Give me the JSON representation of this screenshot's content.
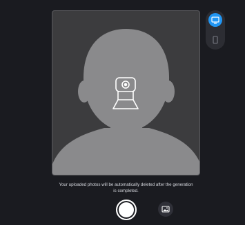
{
  "camera": {
    "placeholder_icon": "person-silhouette",
    "center_icon": "webcam-icon"
  },
  "device_toggle": {
    "options": [
      {
        "name": "desktop-icon",
        "selected": true
      },
      {
        "name": "mobile-icon",
        "selected": false
      }
    ],
    "accent_color": "#2196f3"
  },
  "notice": {
    "line1": "Your uploaded photos will be automatically deleted after the generation",
    "line2": "is completed."
  },
  "controls": {
    "shutter_icon": "shutter-circle-icon",
    "gallery_icon": "image-icon"
  },
  "colors": {
    "background": "#1a1b20",
    "frame": "#3c3c3e",
    "silhouette": "#8a8a8c"
  }
}
